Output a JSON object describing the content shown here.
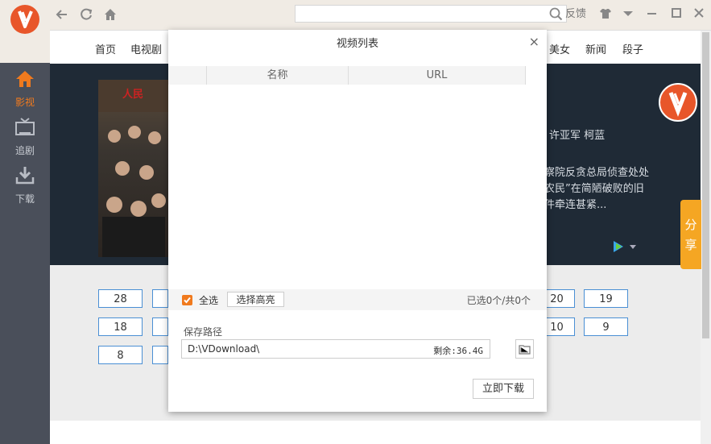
{
  "sidebar": {
    "items": [
      {
        "label": "影视",
        "icon": "home-icon",
        "active": true
      },
      {
        "label": "追剧",
        "icon": "tv-icon"
      },
      {
        "label": "下载",
        "icon": "download-icon"
      }
    ]
  },
  "topbar": {
    "feedback": "反馈",
    "search": {
      "placeholder": "",
      "value": ""
    }
  },
  "categories": [
    "首页",
    "电视剧",
    "美女",
    "新闻",
    "段子"
  ],
  "hero": {
    "cast_fragment": "许亚军  柯蓝",
    "desc_line1": "察院反贪总局侦查处处",
    "desc_line2": "农民”在简陋破败的旧",
    "desc_line3": "件牵连甚紧..."
  },
  "episodes_left": [
    "28",
    "18",
    "8"
  ],
  "episodes_right": [
    [
      "20",
      "19"
    ],
    [
      "10",
      "9"
    ]
  ],
  "share": {
    "line1": "分",
    "line2": "享"
  },
  "modal": {
    "title": "视频列表",
    "close": "×",
    "columns": [
      "名称",
      "URL"
    ],
    "select_all_label": "全选",
    "select_all_checked": true,
    "select_hd_label": "选择高亮",
    "selection_count": "已选0个/共0个",
    "save_path_label": "保存路径",
    "save_path_value": "D:\\VDownload\\",
    "free_space": "剩余:36.4G",
    "download_button": "立即下载"
  },
  "colors": {
    "accent": "#f07a1e",
    "sidebar_bg": "#4a4f5a",
    "episode_border": "#4a8fd4",
    "share_bg": "#f5a623"
  }
}
